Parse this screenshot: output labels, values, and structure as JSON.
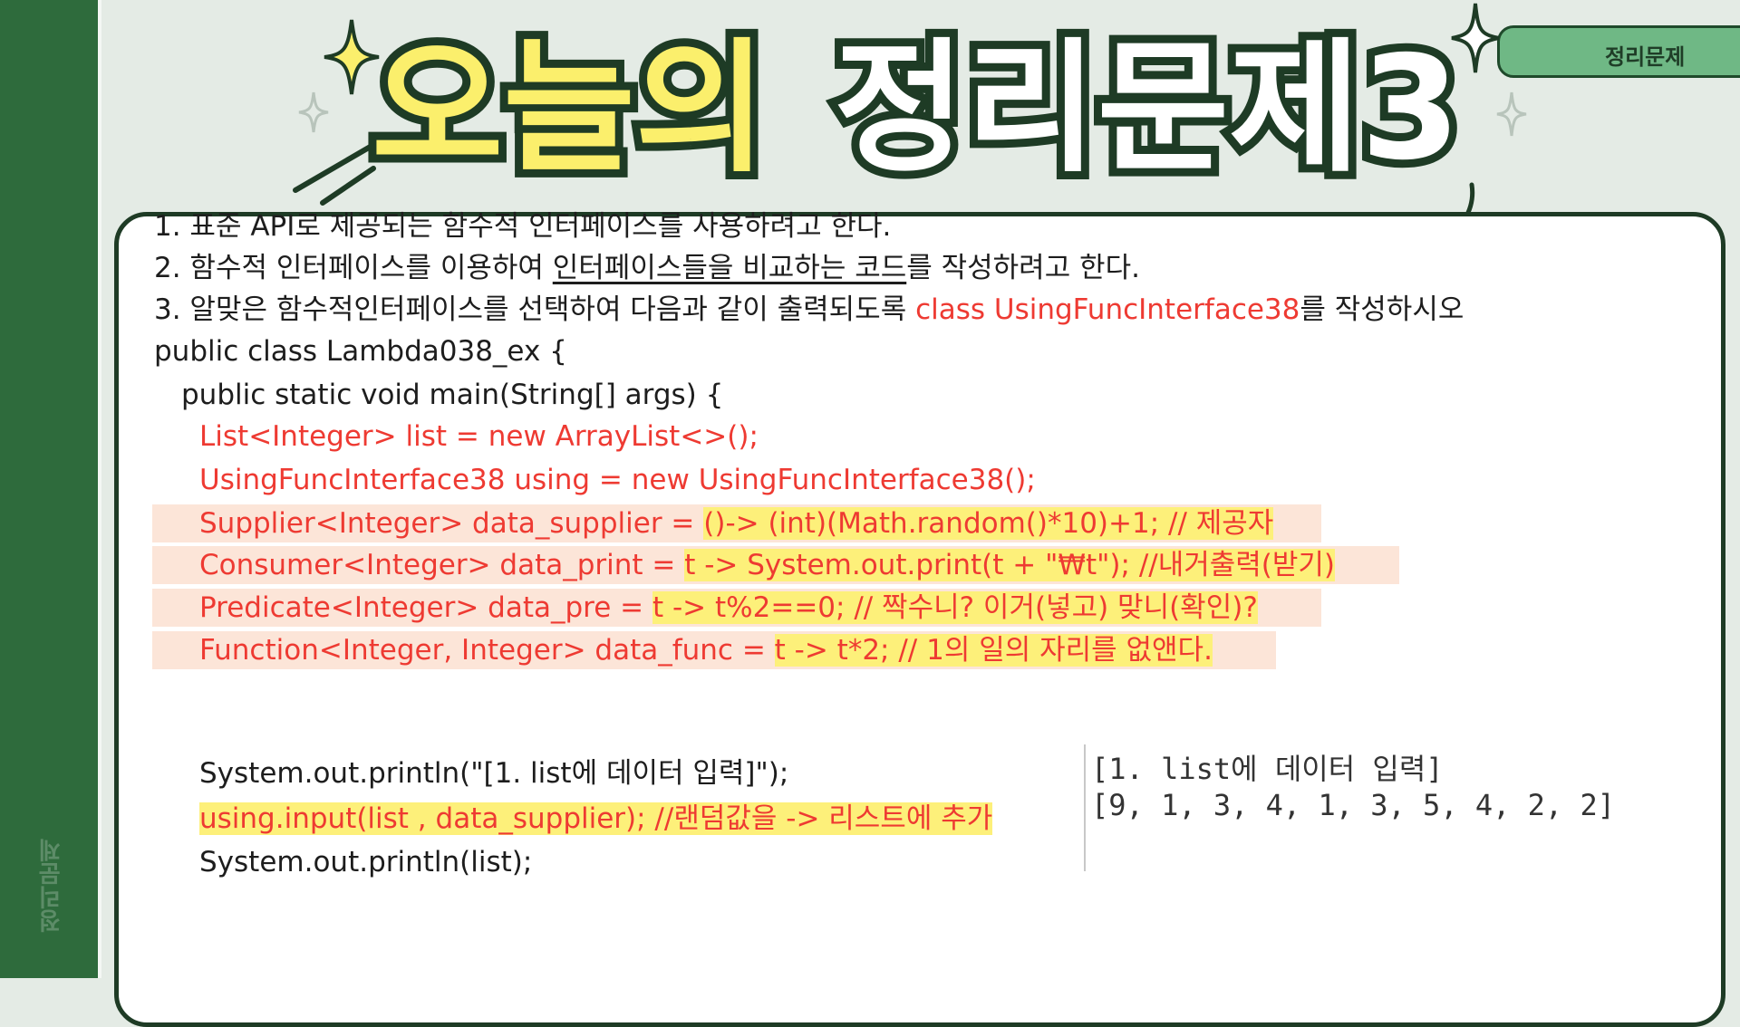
{
  "sidebar": {
    "vertical_label": "정리문제"
  },
  "tab": {
    "label": "정리문제"
  },
  "title": {
    "part1": "오늘의",
    "part2": "정리문제3"
  },
  "colors": {
    "sidebar": "#2e6b3c",
    "title_fill": "#fbef6c",
    "accent_red": "#ee3a32",
    "highlight": "#fdf07a"
  },
  "content": {
    "line1": "1. 표준 API로 제공되는 함수적 인터페이스를 사용하려고 한다.",
    "line2_a": "2. 함수적 인터페이스를 이용하여 ",
    "line2_u": "인터페이스들을 비교하는 코드",
    "line2_b": "를 작성하려고 한다.",
    "line3_a": "3. 알맞은 함수적인터페이스를 선택하여 다음과 같이 출력되도록 ",
    "line3_red": "class UsingFuncInterface38",
    "line3_b": "를 작성하시오",
    "code1": "public class Lambda038_ex {",
    "code2": "public static void main(String[] args) {",
    "code3": "List<Integer> list = new ArrayList<>();",
    "code4": "UsingFuncInterface38 using = new UsingFuncInterface38();",
    "code5_a": "Supplier<Integer> data_supplier = ",
    "code5_b": "()-> (int)(Math.random()*10)+1; // 제공자",
    "code6_a": "Consumer<Integer> data_print = ",
    "code6_b": "t -> System.out.print(t + \"₩t\"); //내거출력(받기)",
    "code7_a": "Predicate<Integer> data_pre = ",
    "code7_b": "t -> t%2==0; // 짝수니? 이거(넣고) 맞니(확인)?",
    "code8_a": "Function<Integer, Integer> data_func = ",
    "code8_b": "t -> t*2; // 1의 일의 자리를 없앤다.",
    "code9": "System.out.println(\"[1. list에 데이터 입력]\");",
    "code10": "using.input(list , data_supplier); //랜덤값을 -> 리스트에 추가",
    "code11": "System.out.println(list);"
  },
  "output": {
    "line1": "[1. list에 데이터 입력]",
    "line2": "[9, 1, 3, 4, 1, 3, 5, 4, 2, 2]"
  }
}
